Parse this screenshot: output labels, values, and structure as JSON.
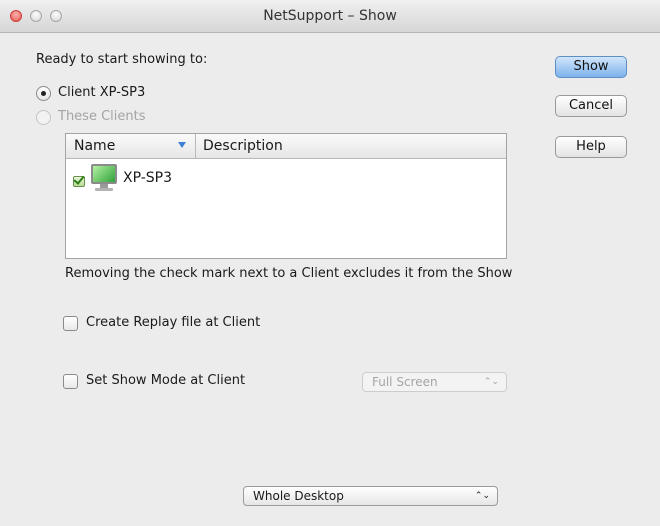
{
  "window": {
    "title": "NetSupport – Show"
  },
  "heading": "Ready to start showing to:",
  "radios": {
    "client_label": "Client XP-SP3",
    "these_clients_label": "These Clients"
  },
  "buttons": {
    "show": "Show",
    "cancel": "Cancel",
    "help": "Help"
  },
  "client_list": {
    "columns": [
      "Name",
      "Description"
    ],
    "rows": [
      {
        "name": "XP-SP3",
        "description": "",
        "checked": true
      }
    ]
  },
  "hint_text": "Removing the check mark next to a Client excludes it from the Show",
  "options": {
    "create_replay_label": "Create Replay file at Client",
    "set_show_mode_label": "Set Show Mode at Client",
    "show_mode_value": "Full Screen",
    "desktop_value": "Whole Desktop"
  },
  "colors": {
    "default_button": "#7cb2ec",
    "close_button": "#e5534b",
    "monitor_screen": "#2fa33a"
  }
}
